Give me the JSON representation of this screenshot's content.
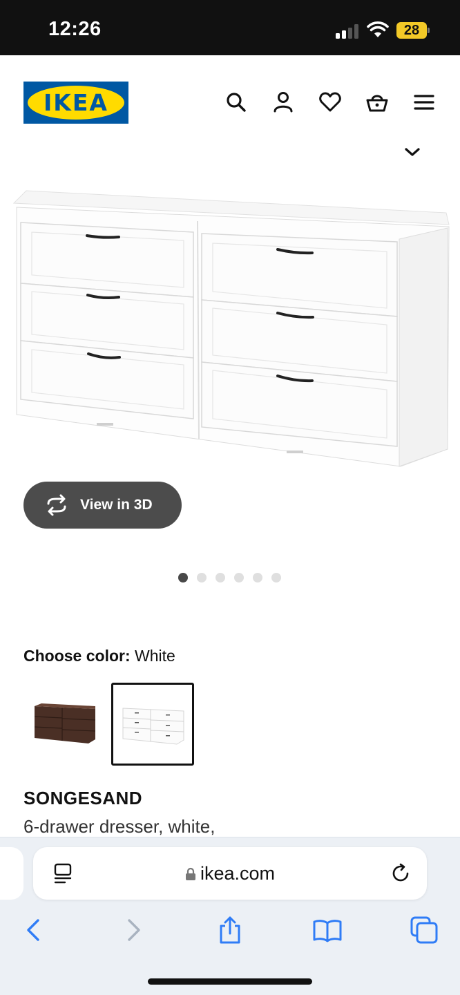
{
  "status_bar": {
    "time": "12:26",
    "battery": "28",
    "icons": [
      "signal-icon",
      "wifi-icon",
      "battery-icon"
    ]
  },
  "header": {
    "logo_text": "IKEA",
    "icons": [
      "search-icon",
      "account-icon",
      "heart-icon",
      "basket-icon",
      "menu-icon"
    ]
  },
  "colors": {
    "ikea_blue": "#0058a3",
    "ikea_yellow": "#ffdb00",
    "button_dark": "#4c4c4c",
    "safari_blue": "#2f7cf6"
  },
  "gallery": {
    "view_3d_label": "View in 3D",
    "dot_count": 6,
    "active_dot": 0
  },
  "color_chooser": {
    "label": "Choose color:",
    "selected_value": "White",
    "swatches": [
      {
        "name": "brown",
        "selected": false
      },
      {
        "name": "white",
        "selected": true
      }
    ]
  },
  "product": {
    "name": "SONGESAND",
    "description": "6-drawer dresser, white,"
  },
  "browser": {
    "url": "ikea.com",
    "icons": [
      "reader-icon",
      "lock-icon",
      "reload-icon",
      "back-icon",
      "forward-icon",
      "share-icon",
      "bookmarks-icon",
      "tabs-icon"
    ]
  }
}
